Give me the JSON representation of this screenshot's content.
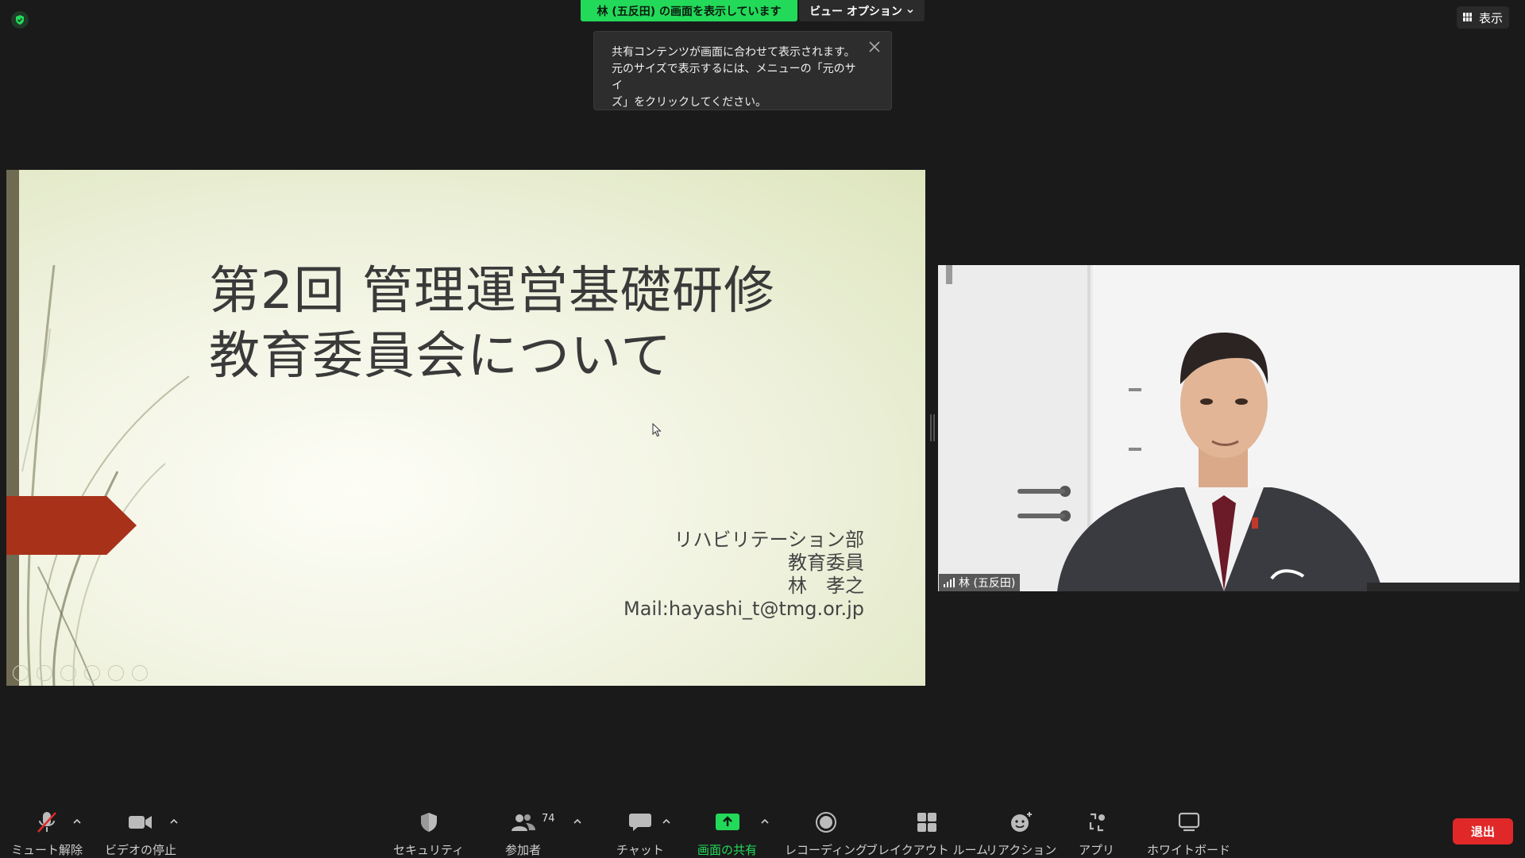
{
  "top": {
    "share_banner": "林 (五反田) の画面を表示しています",
    "view_options": "ビュー オプション",
    "view_button": "表示"
  },
  "tooltip": {
    "line1": "共有コンテンツが画面に合わせて表示されます。",
    "line2": "元のサイズで表示するには、メニューの「元のサイ",
    "line3": "ズ」をクリックしてください。"
  },
  "slide": {
    "title_line1": "第2回 管理運営基礎研修",
    "title_line2": "教育委員会について",
    "info": [
      "リハビリテーション部",
      "教育委員",
      "林　孝之",
      "Mail:hayashi_t@tmg.or.jp"
    ]
  },
  "video": {
    "participant_name": "林 (五反田)"
  },
  "toolbar": {
    "mute": "ミュート解除",
    "video": "ビデオの停止",
    "security": "セキュリティ",
    "participants": "参加者",
    "participants_count": "74",
    "chat": "チャット",
    "share": "画面の共有",
    "recording": "レコーディング",
    "breakout": "ブレイクアウト ルーム",
    "reactions": "リアクション",
    "apps": "アプリ",
    "whiteboard": "ホワイトボード",
    "leave": "退出"
  },
  "colors": {
    "accent_green": "#23d959",
    "leave_red": "#e02828",
    "slide_arrow": "#a8311a"
  }
}
